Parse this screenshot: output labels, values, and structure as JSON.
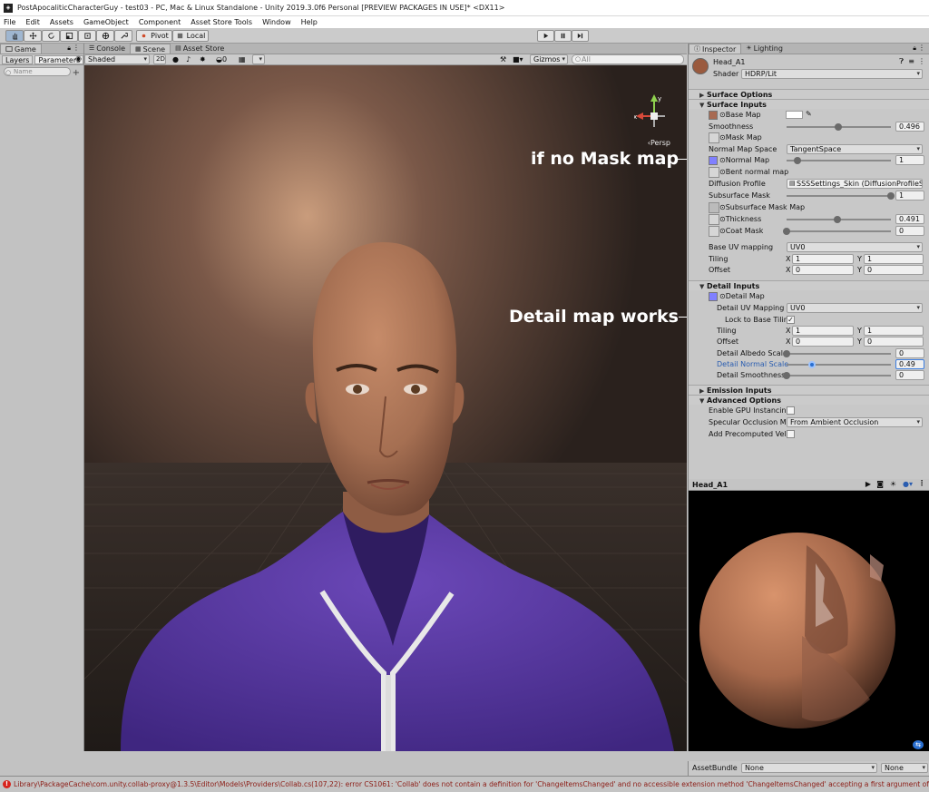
{
  "window": {
    "title": "PostApocaliticCharacterGuy - test03 - PC, Mac & Linux Standalone - Unity 2019.3.0f6 Personal [PREVIEW PACKAGES IN USE]* <DX11>",
    "logo": "◈"
  },
  "menu": [
    "File",
    "Edit",
    "Assets",
    "GameObject",
    "Component",
    "Asset Store Tools",
    "Window",
    "Help"
  ],
  "toolbar": {
    "pivot_label": "Pivot",
    "local_label": "Local"
  },
  "left_panel": {
    "tab_game": "Game",
    "layers": "Layers",
    "parameters": "Parameters",
    "name_placeholder": "Name",
    "add": "+"
  },
  "scene_panel": {
    "tab_console": "Console",
    "tab_scene": "Scene",
    "tab_asset_store": "Asset Store",
    "shading_mode": "Shaded",
    "mode_2d": "2D",
    "fx_count": "0",
    "gizmos": "Gizmos",
    "search_placeholder": "All",
    "persp": "‹Persp",
    "axis_x": "x",
    "axis_y": "y"
  },
  "annotations": {
    "mask_map": "if no Mask map",
    "detail_map": "Detail map works"
  },
  "inspector": {
    "tab_inspector": "Inspector",
    "tab_lighting": "Lighting",
    "material_name": "Head_A1",
    "shader_label": "Shader",
    "shader_value": "HDRP/Lit",
    "surface_options": "Surface Options",
    "surface_inputs": "Surface Inputs",
    "base_map": "Base Map",
    "smoothness": "Smoothness",
    "smoothness_value": "0.496",
    "mask_map": "Mask Map",
    "normal_map_space": "Normal Map Space",
    "normal_map_space_value": "TangentSpace",
    "normal_map": "Normal Map",
    "normal_map_value": "1",
    "bent_normal_map": "Bent normal map",
    "diffusion_profile": "Diffusion Profile",
    "diffusion_profile_value": "SSSSettings_Skin (DiffusionProfileSett",
    "subsurface_mask": "Subsurface Mask",
    "subsurface_mask_value": "1",
    "subsurface_mask_map": "Subsurface Mask Map",
    "thickness": "Thickness",
    "thickness_value": "0.491",
    "coat_mask": "Coat Mask",
    "coat_mask_value": "0",
    "base_uv_mapping": "Base UV mapping",
    "base_uv_mapping_value": "UV0",
    "tiling": "Tiling",
    "offset": "Offset",
    "x": "X",
    "y": "Y",
    "base_tiling_x": "1",
    "base_tiling_y": "1",
    "base_offset_x": "0",
    "base_offset_y": "0",
    "detail_inputs": "Detail Inputs",
    "detail_map": "Detail Map",
    "detail_uv_mapping": "Detail UV Mapping",
    "detail_uv_mapping_value": "UV0",
    "lock_to_base_tiling": "Lock to Base Tiling/",
    "lock_checked": "✓",
    "detail_tiling_x": "1",
    "detail_tiling_y": "1",
    "detail_offset_x": "0",
    "detail_offset_y": "0",
    "detail_albedo_scale": "Detail Albedo Scale",
    "detail_albedo_scale_value": "0",
    "detail_normal_scale": "Detail Normal Scale",
    "detail_normal_scale_value": "0.49",
    "detail_smoothness_scale": "Detail Smoothness Sca",
    "detail_smoothness_scale_value": "0",
    "emission_inputs": "Emission Inputs",
    "advanced_options": "Advanced Options",
    "enable_gpu_instancing": "Enable GPU Instancing",
    "specular_occlusion_mode": "Specular Occlusion Mode",
    "specular_occlusion_mode_value": "From Ambient Occlusion",
    "add_precomputed_velocity": "Add Precomputed Velocit"
  },
  "slider_levels": {
    "smoothness": 0.496,
    "normal_map": 0.0,
    "subsurface_mask": 1.0,
    "thickness": 0.491,
    "coat_mask": 0.0,
    "detail_albedo_scale": 0.0,
    "detail_normal_scale": 0.245,
    "detail_smoothness_scale": 0.0
  },
  "preview": {
    "title": "Head_A1"
  },
  "asset_bundle": {
    "label": "AssetBundle",
    "value": "None",
    "variant": "None"
  },
  "status": {
    "message": "Library\\PackageCache\\com.unity.collab-proxy@1.3.5\\Editor\\Models\\Providers\\Collab.cs(107,22): error CS1061: 'Collab' does not contain a definition for 'ChangeItemsChanged' and no accessible extension method 'ChangeItemsChanged' accepting a first argument of type 'Collab' could be found (are"
  },
  "colors": {
    "hoodie": "#5a3aa6",
    "skin": "#b07a5a",
    "base_map_tint": "#a86a52",
    "normal_map_tint": "#8080ff",
    "error": "#d7231c"
  }
}
